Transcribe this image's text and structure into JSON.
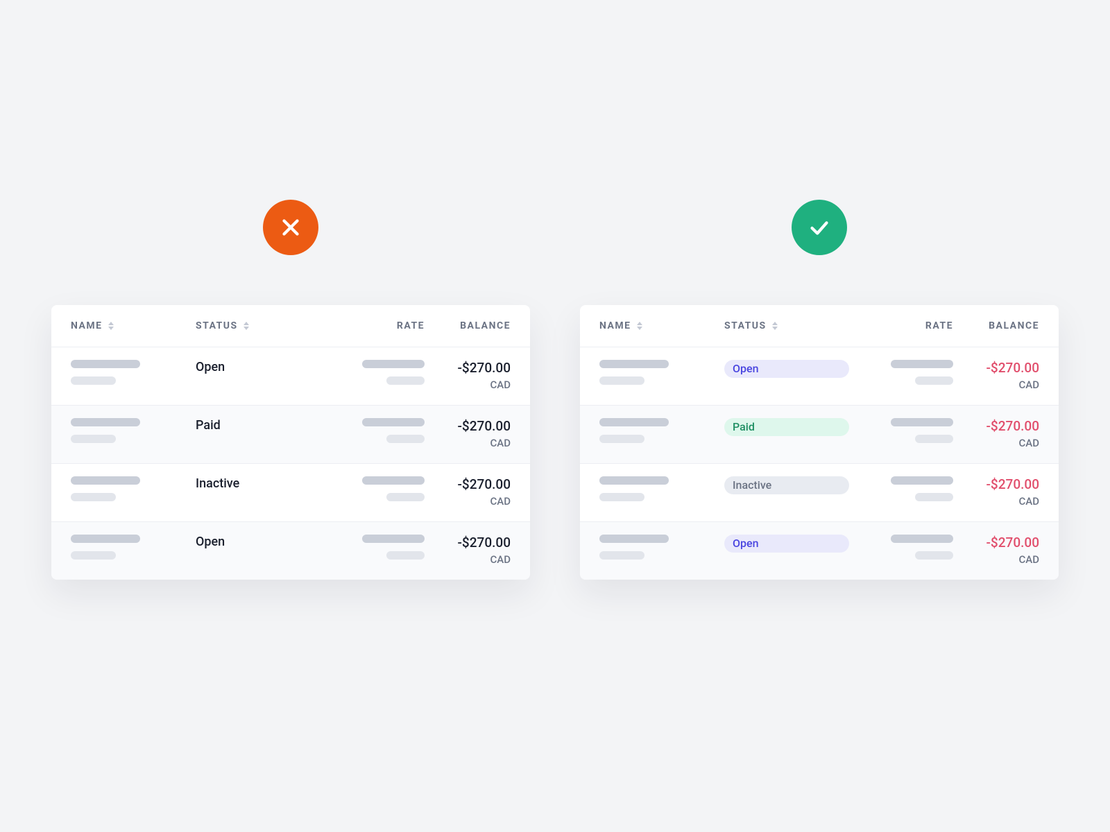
{
  "headers": {
    "name": "NAME",
    "status": "STATUS",
    "rate": "RATE",
    "balance": "BALANCE"
  },
  "bad": {
    "rows": [
      {
        "status": "Open",
        "balance": "-$270.00",
        "currency": "CAD"
      },
      {
        "status": "Paid",
        "balance": "-$270.00",
        "currency": "CAD"
      },
      {
        "status": "Inactive",
        "balance": "-$270.00",
        "currency": "CAD"
      },
      {
        "status": "Open",
        "balance": "-$270.00",
        "currency": "CAD"
      }
    ]
  },
  "good": {
    "rows": [
      {
        "status": "Open",
        "status_kind": "open",
        "balance": "-$270.00",
        "currency": "CAD"
      },
      {
        "status": "Paid",
        "status_kind": "paid",
        "balance": "-$270.00",
        "currency": "CAD"
      },
      {
        "status": "Inactive",
        "status_kind": "inactive",
        "balance": "-$270.00",
        "currency": "CAD"
      },
      {
        "status": "Open",
        "status_kind": "open",
        "balance": "-$270.00",
        "currency": "CAD"
      }
    ]
  }
}
